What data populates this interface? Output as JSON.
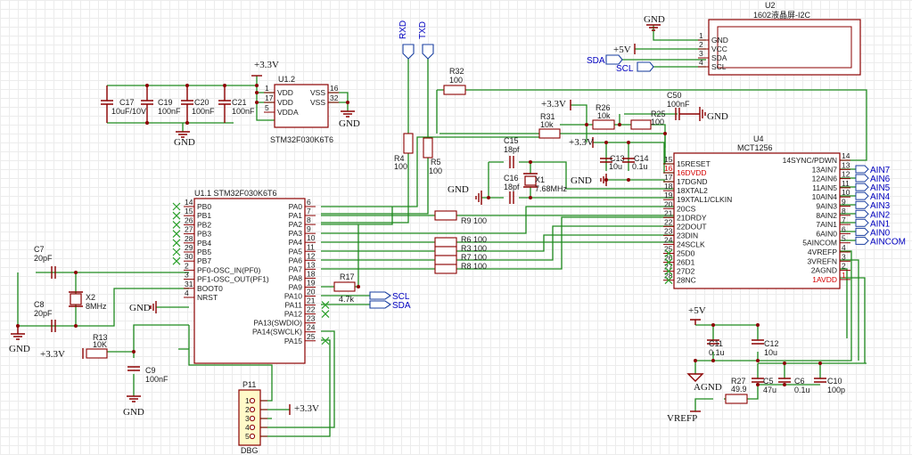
{
  "power": {
    "p3v3": "+3.3V",
    "gnd": "GND",
    "p5v": "+5V",
    "agnd": "AGND",
    "vrefp": "VREFP"
  },
  "nets": {
    "rxd": "RXD",
    "txd": "TXD",
    "scl": "SCL",
    "sda": "SDA",
    "gnd": "GND"
  },
  "u12": {
    "ref": "U1.2",
    "part": "STM32F030K6T6",
    "left": [
      {
        "num": "1",
        "name": "VDD"
      },
      {
        "num": "17",
        "name": "VDD"
      },
      {
        "num": "5",
        "name": "VDDA"
      }
    ],
    "right": [
      {
        "num": "16",
        "name": "VSS"
      },
      {
        "num": "32",
        "name": "VSS"
      }
    ]
  },
  "u11": {
    "ref": "U1.1",
    "part": "STM32F030K6T6",
    "left": [
      {
        "num": "14",
        "name": "PB0"
      },
      {
        "num": "15",
        "name": "PB1"
      },
      {
        "num": "26",
        "name": "PB2"
      },
      {
        "num": "27",
        "name": "PB3"
      },
      {
        "num": "28",
        "name": "PB4"
      },
      {
        "num": "29",
        "name": "PB5"
      },
      {
        "num": "30",
        "name": "PB7"
      },
      {
        "num": "2",
        "name": "PF0-OSC_IN(PF0)"
      },
      {
        "num": "3",
        "name": "PF1-OSC_OUT(PF1)"
      },
      {
        "num": "31",
        "name": "BOOT0"
      },
      {
        "num": "4",
        "name": "NRST"
      }
    ],
    "right": [
      {
        "num": "6",
        "name": "PA0"
      },
      {
        "num": "7",
        "name": "PA1"
      },
      {
        "num": "8",
        "name": "PA2"
      },
      {
        "num": "9",
        "name": "PA3"
      },
      {
        "num": "10",
        "name": "PA4"
      },
      {
        "num": "11",
        "name": "PA5"
      },
      {
        "num": "12",
        "name": "PA6"
      },
      {
        "num": "13",
        "name": "PA7"
      },
      {
        "num": "18",
        "name": "PA8"
      },
      {
        "num": "19",
        "name": "PA9"
      },
      {
        "num": "20",
        "name": "PA10"
      },
      {
        "num": "21",
        "name": "PA11"
      },
      {
        "num": "22",
        "name": "PA12"
      },
      {
        "num": "23",
        "name": "PA13(SWDIO)"
      },
      {
        "num": "24",
        "name": "PA14(SWCLK)"
      },
      {
        "num": "25",
        "name": "PA15"
      }
    ]
  },
  "u4": {
    "ref": "U4",
    "part": "MCT1256",
    "left": [
      {
        "num": "15",
        "name": "15RESET",
        "red": false
      },
      {
        "num": "16",
        "name": "16DVDD",
        "red": true
      },
      {
        "num": "17",
        "name": "17DGND",
        "red": false
      },
      {
        "num": "18",
        "name": "18XTAL2",
        "red": false
      },
      {
        "num": "19",
        "name": "19XTAL1/CLKIN",
        "red": false
      },
      {
        "num": "20",
        "name": "20CS",
        "red": false
      },
      {
        "num": "21",
        "name": "21DRDY",
        "red": false
      },
      {
        "num": "22",
        "name": "22DOUT",
        "red": false
      },
      {
        "num": "23",
        "name": "23DIN",
        "red": false
      },
      {
        "num": "24",
        "name": "24SCLK",
        "red": false
      },
      {
        "num": "25",
        "name": "25D0",
        "red": false
      },
      {
        "num": "26",
        "name": "26D1",
        "red": false
      },
      {
        "num": "27",
        "name": "27D2",
        "red": false
      },
      {
        "num": "28",
        "name": "28NC",
        "red": false
      }
    ],
    "right": [
      {
        "num": "14",
        "name": "14SYNC/PDWN",
        "red": false
      },
      {
        "num": "13",
        "name": "13AIN7",
        "red": false
      },
      {
        "num": "12",
        "name": "12AIN6",
        "red": false
      },
      {
        "num": "11",
        "name": "11AIN5",
        "red": false
      },
      {
        "num": "10",
        "name": "10AIN4",
        "red": false
      },
      {
        "num": "9",
        "name": "9AIN3",
        "red": false
      },
      {
        "num": "8",
        "name": "8AIN2",
        "red": false
      },
      {
        "num": "7",
        "name": "7AIN1",
        "red": false
      },
      {
        "num": "6",
        "name": "6AIN0",
        "red": false
      },
      {
        "num": "5",
        "name": "5AINCOM",
        "red": false
      },
      {
        "num": "4",
        "name": "4VREFP",
        "red": false
      },
      {
        "num": "3",
        "name": "3VREFN",
        "red": false
      },
      {
        "num": "2",
        "name": "2AGND",
        "red": false
      },
      {
        "num": "1",
        "name": "1AVDD",
        "red": true
      }
    ],
    "ports": [
      "AIN7",
      "AIN6",
      "AIN5",
      "AIN4",
      "AIN3",
      "AIN2",
      "AIN1",
      "AIN0",
      "AINCOM"
    ]
  },
  "u2": {
    "ref": "U2",
    "part": "1602液晶屏-I2C",
    "pins": [
      {
        "num": "1",
        "name": "GND"
      },
      {
        "num": "2",
        "name": "VCC"
      },
      {
        "num": "3",
        "name": "SDA"
      },
      {
        "num": "4",
        "name": "SCL"
      }
    ]
  },
  "p11": {
    "ref": "P11",
    "part": "DBG",
    "pins": [
      "1",
      "2",
      "3",
      "4",
      "5"
    ]
  },
  "parts": {
    "c17": {
      "ref": "C17",
      "val": "10uF/10V"
    },
    "c19": {
      "ref": "C19",
      "val": "100nF"
    },
    "c20": {
      "ref": "C20",
      "val": "100nF"
    },
    "c21": {
      "ref": "C21",
      "val": "100nF"
    },
    "c7": {
      "ref": "C7",
      "val": "20pF"
    },
    "c8": {
      "ref": "C8",
      "val": "20pF"
    },
    "x2": {
      "ref": "X2",
      "val": "8MHz"
    },
    "r13": {
      "ref": "R13",
      "val": "10K"
    },
    "c9": {
      "ref": "C9",
      "val": "100nF"
    },
    "r4": {
      "ref": "R4",
      "val": "100"
    },
    "r5": {
      "ref": "R5",
      "val": "100"
    },
    "r32": {
      "ref": "R32",
      "val": "100"
    },
    "r17": {
      "ref": "R17",
      "val": "4.7k"
    },
    "r9": {
      "ref": "R9",
      "val": "100"
    },
    "r6": {
      "ref": "R6",
      "val": "100"
    },
    "r3": {
      "ref": "R3",
      "val": "100"
    },
    "r7": {
      "ref": "R7",
      "val": "100"
    },
    "r8": {
      "ref": "R8",
      "val": "100"
    },
    "c15": {
      "ref": "C15",
      "val": "18pf"
    },
    "c16": {
      "ref": "C16",
      "val": "18pf"
    },
    "x1": {
      "ref": "X1",
      "val": "7.68MHz"
    },
    "r31": {
      "ref": "R31",
      "val": "10k"
    },
    "r26": {
      "ref": "R26",
      "val": "10k"
    },
    "r25": {
      "ref": "R25",
      "val": "100"
    },
    "c50": {
      "ref": "C50",
      "val": "100nF"
    },
    "c13": {
      "ref": "C13",
      "val": "10u"
    },
    "c14": {
      "ref": "C14",
      "val": "0.1u"
    },
    "c11": {
      "ref": "C11",
      "val": "0.1u"
    },
    "c12": {
      "ref": "C12",
      "val": "10u"
    },
    "r27": {
      "ref": "R27",
      "val": "49.9"
    },
    "c5": {
      "ref": "C5",
      "val": "47u"
    },
    "c6": {
      "ref": "C6",
      "val": "0.1u"
    },
    "c10": {
      "ref": "C10",
      "val": "100p"
    }
  }
}
